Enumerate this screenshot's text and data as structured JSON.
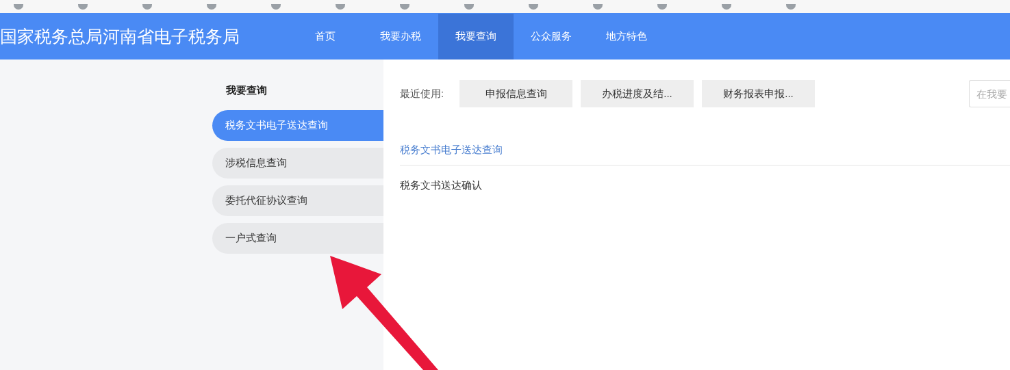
{
  "header": {
    "title": "国家税务总局河南省电子税务局",
    "nav": [
      {
        "label": "首页",
        "selected": false
      },
      {
        "label": "我要办税",
        "selected": false
      },
      {
        "label": "我要查询",
        "selected": true
      },
      {
        "label": "公众服务",
        "selected": false
      },
      {
        "label": "地方特色",
        "selected": false
      }
    ]
  },
  "sidebar": {
    "title": "我要查询",
    "items": [
      {
        "label": "税务文书电子送达查询",
        "selected": true
      },
      {
        "label": "涉税信息查询",
        "selected": false
      },
      {
        "label": "委托代征协议查询",
        "selected": false
      },
      {
        "label": "一户式查询",
        "selected": false
      }
    ]
  },
  "recent": {
    "label": "最近使用:",
    "items": [
      "申报信息查询",
      "办税进度及结...",
      "财务报表申报..."
    ]
  },
  "search": {
    "placeholder": "在我要"
  },
  "content": {
    "heading": "税务文书电子送达查询",
    "items": [
      "税务文书送达确认"
    ]
  }
}
